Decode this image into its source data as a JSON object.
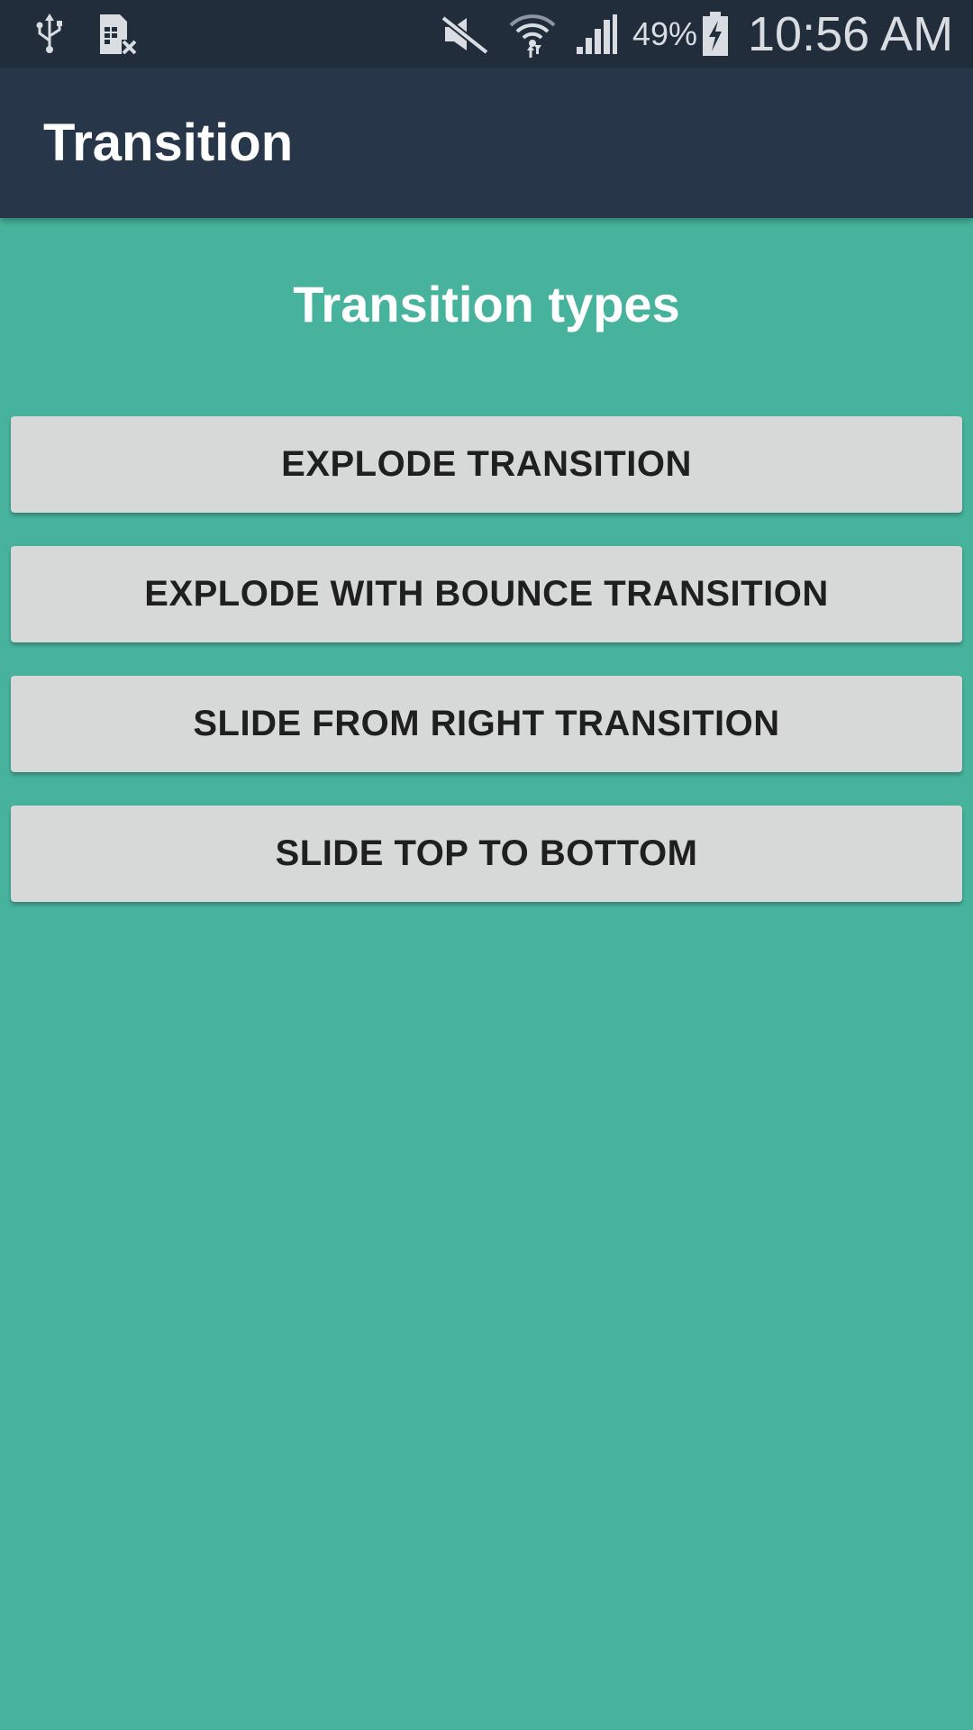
{
  "status_bar": {
    "icons": [
      "usb-icon",
      "sim-card-error-icon",
      "mute-icon",
      "wifi-icon",
      "cellular-signal-icon",
      "battery-charging-icon"
    ],
    "battery_percent": "49%",
    "time": "10:56 AM"
  },
  "app_bar": {
    "title": "Transition"
  },
  "main": {
    "heading": "Transition types",
    "buttons": [
      {
        "label": "EXPLODE TRANSITION"
      },
      {
        "label": "EXPLODE WITH BOUNCE TRANSITION"
      },
      {
        "label": "SLIDE FROM RIGHT TRANSITION"
      },
      {
        "label": "SLIDE TOP TO BOTTOM"
      }
    ]
  },
  "colors": {
    "status_bar_bg": "#212d3a",
    "app_bar_bg": "#273749",
    "content_bg": "#47b39d",
    "button_bg": "#d7d8d8",
    "button_text": "#1f1f1f"
  }
}
